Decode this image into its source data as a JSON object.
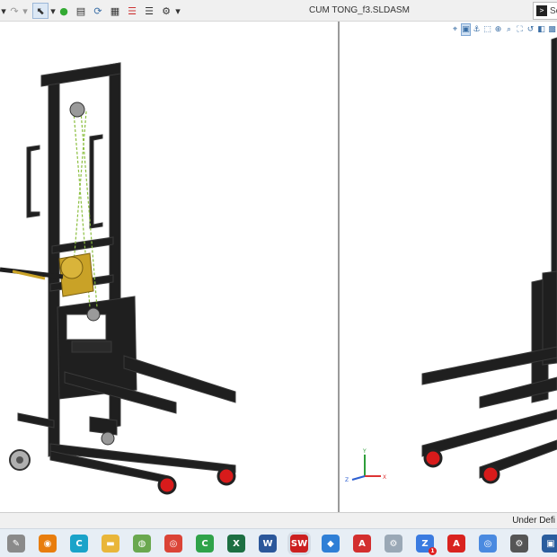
{
  "window": {
    "title": "CUM TONG_f3.SLDASM",
    "search_label": "Se"
  },
  "toolbar": {
    "items": [
      {
        "name": "options-dropdown-icon",
        "glyph": "▾"
      },
      {
        "name": "redo-icon",
        "glyph": "↷"
      },
      {
        "name": "redo-dropdown-icon",
        "glyph": "▾"
      },
      {
        "name": "select-arrow-icon",
        "glyph": "⬉"
      },
      {
        "name": "select-dropdown-icon",
        "glyph": "▾"
      },
      {
        "name": "traffic-light-icon",
        "glyph": "●"
      },
      {
        "name": "file-properties-icon",
        "glyph": "▤"
      },
      {
        "name": "rebuild-icon",
        "glyph": "⟳"
      },
      {
        "name": "file-icon",
        "glyph": "▦"
      },
      {
        "name": "list-icon",
        "glyph": "☰"
      },
      {
        "name": "settings-gear-icon",
        "glyph": "⚙"
      },
      {
        "name": "settings-dropdown-icon",
        "glyph": "▾"
      }
    ]
  },
  "view_toolbar": {
    "icons": [
      "⌖",
      "▣",
      "⚓",
      "⬚",
      "⊕",
      "⌕",
      "⛶",
      "↺",
      "◧",
      "▩"
    ]
  },
  "status": {
    "text": "Under Defi"
  },
  "taskbar": {
    "apps": [
      {
        "name": "tools-app-icon",
        "label": "✎",
        "color": "#8a8a8a"
      },
      {
        "name": "blender-app-icon",
        "label": "◉",
        "color": "#e87d0d"
      },
      {
        "name": "c-app-icon",
        "label": "C",
        "color": "#1aa3c9"
      },
      {
        "name": "file-explorer-app-icon",
        "label": "▬",
        "color": "#e9b63a"
      },
      {
        "name": "green-app-icon",
        "label": "◍",
        "color": "#6aa84f"
      },
      {
        "name": "chrome-app-icon",
        "label": "◎",
        "color": "#db4437"
      },
      {
        "name": "camtasia-app-icon",
        "label": "C",
        "color": "#2fa34a"
      },
      {
        "name": "excel-app-icon",
        "label": "X",
        "color": "#1d6f42"
      },
      {
        "name": "word-app-icon",
        "label": "W",
        "color": "#2b579a"
      },
      {
        "name": "solidworks-app-icon",
        "label": "SW",
        "color": "#cc1f1f",
        "active": true
      },
      {
        "name": "blue-app-icon",
        "label": "◆",
        "color": "#2f7fd6"
      },
      {
        "name": "autocad-app-icon",
        "label": "A",
        "color": "#d32f2f"
      },
      {
        "name": "network-app-icon",
        "label": "⚙",
        "color": "#9aa8b6"
      },
      {
        "name": "zalo-app-icon",
        "label": "Z",
        "color": "#3a7be0",
        "badge": "1"
      },
      {
        "name": "acrobat-app-icon",
        "label": "A",
        "color": "#d9231f"
      },
      {
        "name": "chrome-profile-app-icon",
        "label": "◎",
        "color": "#4a8ae0"
      },
      {
        "name": "settings-app-icon",
        "label": "⚙",
        "color": "#555"
      },
      {
        "name": "other-app-icon",
        "label": "▣",
        "color": "#2a5d9e"
      }
    ]
  },
  "colors": {
    "frame": "#1f1f1f",
    "frame_edge": "#3a3a3a",
    "winch": "#c9a227",
    "wheel_red": "#d81b1b",
    "cable": "#8bbf3f"
  }
}
